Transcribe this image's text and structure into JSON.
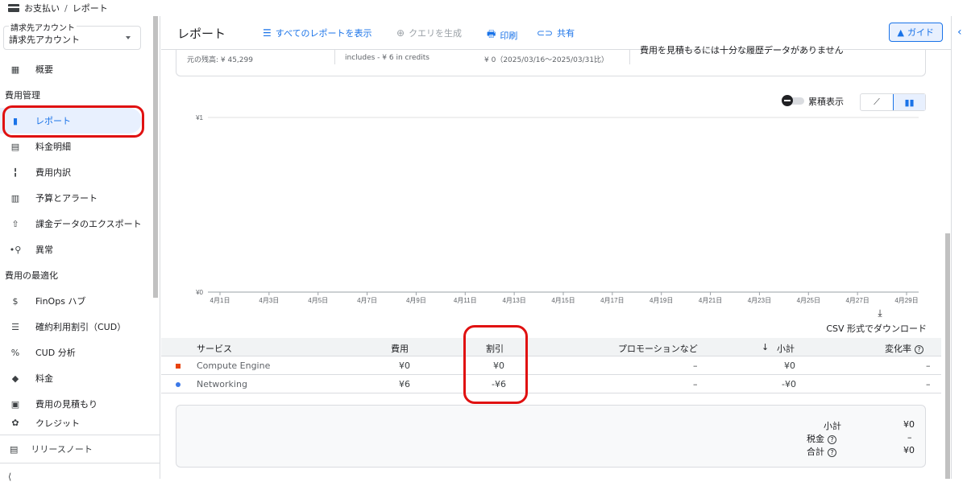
{
  "breadcrumb": {
    "root": "お支払い",
    "separator": "/",
    "current": "レポート"
  },
  "account": {
    "label": "請求先アカウント",
    "value": "請求先アカウント"
  },
  "sidebar": {
    "items": [
      {
        "label": "概要",
        "icon": "dashboard-icon"
      },
      {
        "section": "費用管理"
      },
      {
        "label": "レポート",
        "icon": "bar-chart-icon",
        "active": true
      },
      {
        "label": "料金明細",
        "icon": "table-icon"
      },
      {
        "label": "費用内訳",
        "icon": "waterfall-icon"
      },
      {
        "label": "予算とアラート",
        "icon": "budget-icon"
      },
      {
        "label": "課金データのエクスポート",
        "icon": "export-icon"
      },
      {
        "label": "異常",
        "icon": "anomaly-icon"
      },
      {
        "section": "費用の最適化"
      },
      {
        "label": "FinOps ハブ",
        "icon": "dollar-icon"
      },
      {
        "label": "確約利用割引（CUD）",
        "icon": "list-icon"
      },
      {
        "label": "CUD 分析",
        "icon": "percent-icon"
      },
      {
        "label": "料金",
        "icon": "tag-icon"
      },
      {
        "label": "費用の見積もり",
        "icon": "calculator-icon"
      },
      {
        "label": "クレジット",
        "icon": "credit-icon"
      }
    ],
    "footer": "リリースノート"
  },
  "header": {
    "title": "レポート",
    "view_all": "すべてのレポートを表示",
    "create_query": "クエリを生成",
    "print": "印刷",
    "share": "共有",
    "guide": "ガイド"
  },
  "summary": {
    "remaining": "元の残高: ¥ 45,299",
    "credits": "includes - ¥ 6 in credits",
    "compare": "¥ 0（2025/03/16～2025/03/31比）",
    "note": "費用を見積もるには十分な履歴データがありません"
  },
  "controls": {
    "cumulative": "累積表示"
  },
  "chart_data": {
    "type": "bar",
    "categories": [
      "4月1日",
      "4月3日",
      "4月5日",
      "4月7日",
      "4月9日",
      "4月11日",
      "4月13日",
      "4月15日",
      "4月17日",
      "4月19日",
      "4月21日",
      "4月23日",
      "4月25日",
      "4月27日",
      "4月29日"
    ],
    "values": [
      0,
      0,
      0,
      0,
      0,
      0,
      0,
      0,
      0,
      0,
      0,
      0,
      0,
      0,
      0
    ],
    "yticks": [
      "¥0",
      "¥1"
    ],
    "ylim": [
      0,
      1
    ],
    "grid": true
  },
  "download": "CSV 形式でダウンロード",
  "table": {
    "headers": {
      "service": "サービス",
      "cost": "費用",
      "discount": "割引",
      "promo": "プロモーションなど",
      "subtotal": "小計",
      "change": "変化率"
    },
    "rows": [
      {
        "service": "Compute Engine",
        "color": "#e8430f",
        "cost": "¥0",
        "discount": "¥0",
        "promo": "–",
        "subtotal": "¥0",
        "change": "–"
      },
      {
        "service": "Networking",
        "color": "#3b78e7",
        "cost": "¥6",
        "discount": "-¥6",
        "promo": "–",
        "subtotal": "-¥0",
        "change": "–"
      }
    ]
  },
  "totals": {
    "subtotal_label": "小計",
    "subtotal": "¥0",
    "tax_label": "税金",
    "tax": "–",
    "total_label": "合計",
    "total": "¥0"
  }
}
